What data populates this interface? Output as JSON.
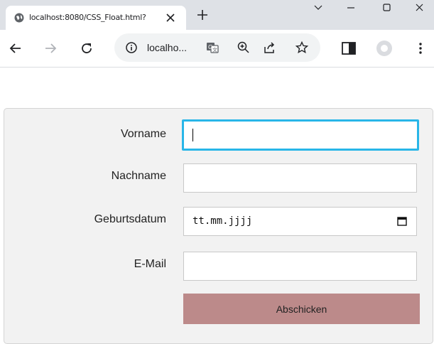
{
  "tab": {
    "title": "localhost:8080/CSS_Float.html?"
  },
  "omnibox": {
    "url": "localho..."
  },
  "form": {
    "fields": [
      {
        "label": "Vorname",
        "value": ""
      },
      {
        "label": "Nachname",
        "value": ""
      },
      {
        "label": "Geburtsdatum",
        "placeholder": "tt.mm.jjjj"
      },
      {
        "label": "E-Mail",
        "value": ""
      }
    ],
    "submit_label": "Abschicken"
  },
  "colors": {
    "focus_border": "#29b6e8",
    "submit_bg": "#bc8a8a",
    "form_bg": "#f2f2f2"
  },
  "icons": [
    "globe-icon",
    "close-icon",
    "plus-icon",
    "chevron-down-icon",
    "minimize-icon",
    "maximize-icon",
    "back-icon",
    "forward-icon",
    "reload-icon",
    "info-icon",
    "translate-icon",
    "zoom-icon",
    "share-icon",
    "star-icon",
    "sidepanel-icon",
    "profile-icon",
    "menu-icon",
    "calendar-icon"
  ]
}
